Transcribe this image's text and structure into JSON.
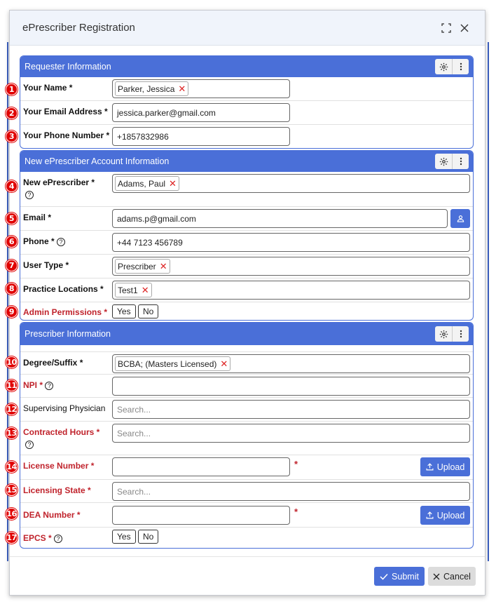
{
  "dialog": {
    "title": "ePrescriber Registration"
  },
  "requester": {
    "title": "Requester Information",
    "name_label": "Your Name *",
    "name_value": "Parker, Jessica",
    "email_label": "Your Email Address *",
    "email_value": "jessica.parker@gmail.com",
    "phone_label": "Your Phone Number *",
    "phone_value": "+1857832986"
  },
  "account": {
    "title": "New ePrescriber Account Information",
    "eprescriber_label": "New ePrescriber *",
    "eprescriber_value": "Adams, Paul",
    "email_label": "Email *",
    "email_value": "adams.p@gmail.com",
    "phone_label": "Phone *",
    "phone_value": "+44 7123 456789",
    "user_type_label": "User Type *",
    "user_type_value": "Prescriber",
    "locations_label": "Practice Locations *",
    "locations_value": "Test1",
    "admin_label": "Admin Permissions *",
    "yes": "Yes",
    "no": "No"
  },
  "prescriber": {
    "title": "Prescriber Information",
    "degree_label": "Degree/Suffix *",
    "degree_value": "BCBA; (Masters Licensed)",
    "npi_label": "NPI *",
    "npi_value": "",
    "supervising_label": "Supervising Physician",
    "supervising_placeholder": "Search...",
    "hours_label": "Contracted Hours *",
    "hours_placeholder": "Search...",
    "license_label": "License Number *",
    "license_value": "",
    "state_label": "Licensing State *",
    "state_placeholder": "Search...",
    "dea_label": "DEA Number *",
    "dea_value": "",
    "epcs_label": "EPCS *",
    "upload": "Upload",
    "yes": "Yes",
    "no": "No",
    "required_star": "*"
  },
  "footer": {
    "submit": "Submit",
    "cancel": "Cancel"
  },
  "markers": [
    "1",
    "2",
    "3",
    "4",
    "5",
    "6",
    "7",
    "8",
    "9",
    "10",
    "11",
    "12",
    "13",
    "14",
    "15",
    "16",
    "17"
  ],
  "help_glyph": "?",
  "remove_glyph": "✕",
  "colors": {
    "accent": "#4a6fd8",
    "required": "#c0232c",
    "marker": "#e00000"
  }
}
